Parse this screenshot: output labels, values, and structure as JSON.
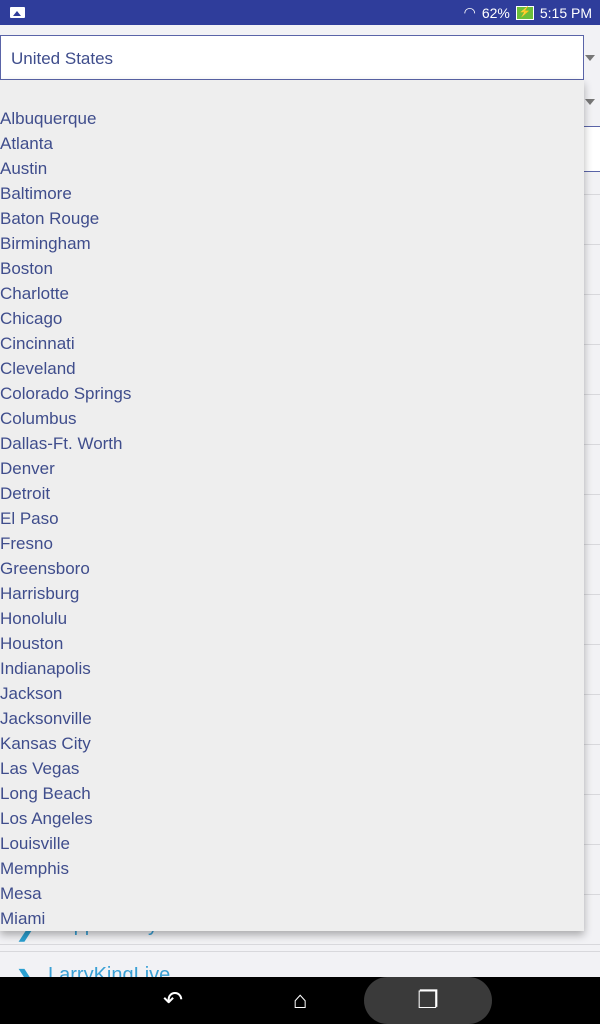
{
  "status_bar": {
    "battery": "62%",
    "time": "5:15 PM",
    "colors": {
      "bar": "#2f3d9b"
    }
  },
  "country_spinner": {
    "value": "United States"
  },
  "background_list": [
    {
      "label": "Rapper Troy Ave"
    },
    {
      "label": "LarryKingLive"
    }
  ],
  "city_dropdown": {
    "items": [
      "Albuquerque",
      "Atlanta",
      "Austin",
      "Baltimore",
      "Baton Rouge",
      "Birmingham",
      "Boston",
      "Charlotte",
      "Chicago",
      "Cincinnati",
      "Cleveland",
      "Colorado Springs",
      "Columbus",
      "Dallas-Ft. Worth",
      "Denver",
      "Detroit",
      "El Paso",
      "Fresno",
      "Greensboro",
      "Harrisburg",
      "Honolulu",
      "Houston",
      "Indianapolis",
      "Jackson",
      "Jacksonville",
      "Kansas City",
      "Las Vegas",
      "Long Beach",
      "Los Angeles",
      "Louisville",
      "Memphis",
      "Mesa",
      "Miami"
    ]
  },
  "nav_bar": {
    "back": "back-icon",
    "home": "home-icon",
    "recents": "recents-icon"
  }
}
